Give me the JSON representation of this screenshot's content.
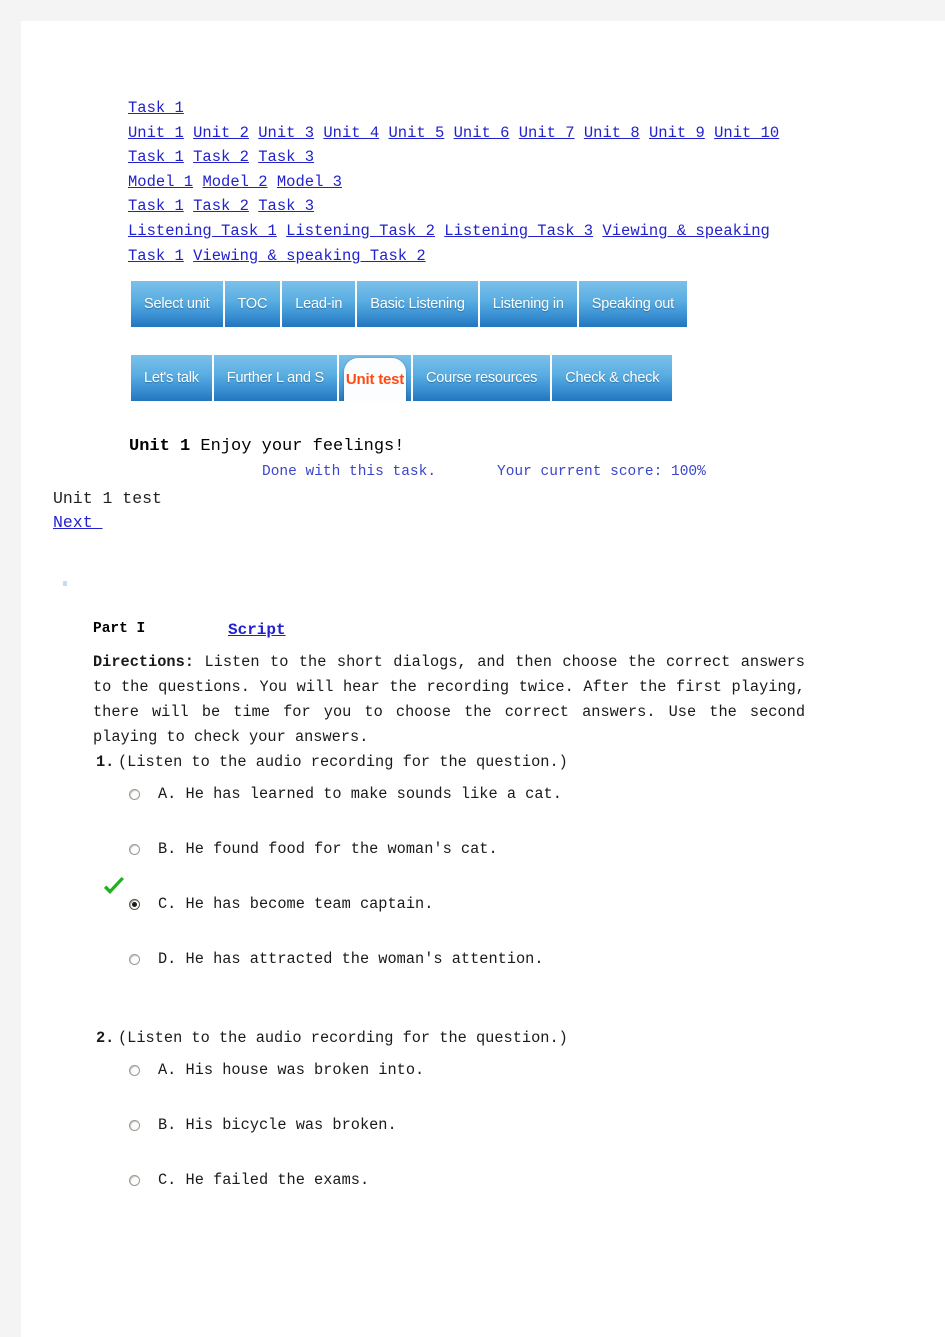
{
  "page": {
    "background_color": "#ffffff",
    "gutter_color": "#f4f4f5",
    "link_color": "#2222cc",
    "accent_color": "#ff4a12",
    "status_color": "#3a46cc",
    "check_color": "#22b022"
  },
  "index_links": {
    "row1": [
      "Task 1"
    ],
    "row2": [
      "Unit 1",
      "Unit 2",
      "Unit 3",
      "Unit 4",
      "Unit 5",
      "Unit 6",
      "Unit 7",
      "Unit 8",
      "Unit 9",
      "Unit 10"
    ],
    "row3": [
      "Task 1",
      "Task 2",
      "Task 3"
    ],
    "row4": [
      "Model 1",
      "Model 2",
      "Model 3"
    ],
    "row5": [
      "Task 1",
      "Task 2",
      "Task 3"
    ],
    "row6": [
      "Listening Task 1",
      "Listening Task 2",
      "Listening Task 3",
      "Viewing & speaking Task 1",
      "Viewing & speaking Task 2"
    ]
  },
  "navbar_primary": {
    "items": [
      {
        "label": "Select unit",
        "active": false
      },
      {
        "label": "TOC",
        "active": false
      },
      {
        "label": "Lead-in",
        "active": false
      },
      {
        "label": "Basic Listening",
        "active": false
      },
      {
        "label": "Listening in",
        "active": false
      },
      {
        "label": "Speaking out",
        "active": false
      }
    ]
  },
  "navbar_secondary": {
    "items": [
      {
        "label": "Let's talk",
        "active": false
      },
      {
        "label": "Further L and S",
        "active": false
      },
      {
        "label": "Unit test",
        "active": true
      },
      {
        "label": "Course resources",
        "active": false
      },
      {
        "label": "Check & check",
        "active": false
      }
    ]
  },
  "heading": {
    "unit_label": "Unit 1",
    "unit_title": " Enjoy your feelings!"
  },
  "status": {
    "done_text": "Done with this task.",
    "score_text": "Your current score: 100%"
  },
  "test": {
    "title": "Unit 1 test",
    "next_link": "Next "
  },
  "part": {
    "label": "Part I",
    "script_link": "Script",
    "directions_label": "Directions:",
    "directions_text": " Listen to the short dialogs, and then choose the correct answers to the questions. You will hear the recording twice. After the first playing, there will be time for you to choose the correct answers. Use the second playing to check your answers."
  },
  "questions": [
    {
      "number": "1.",
      "stem": "(Listen to the audio recording for the question.)",
      "options": [
        {
          "letter": "A.",
          "text": "He has learned to make sounds like a cat.",
          "selected": false,
          "correct": false
        },
        {
          "letter": "B.",
          "text": "He found food for the woman's cat.",
          "selected": false,
          "correct": false
        },
        {
          "letter": "C.",
          "text": "He has become team captain.",
          "selected": true,
          "correct": true
        },
        {
          "letter": "D.",
          "text": "He has attracted the woman's attention.",
          "selected": false,
          "correct": false
        }
      ]
    },
    {
      "number": "2.",
      "stem": "(Listen to the audio recording for the question.)",
      "options": [
        {
          "letter": "A.",
          "text": "His house was broken into.",
          "selected": false,
          "correct": false
        },
        {
          "letter": "B.",
          "text": "His bicycle was broken.",
          "selected": false,
          "correct": false
        },
        {
          "letter": "C.",
          "text": "He failed the exams.",
          "selected": false,
          "correct": false
        }
      ]
    }
  ]
}
